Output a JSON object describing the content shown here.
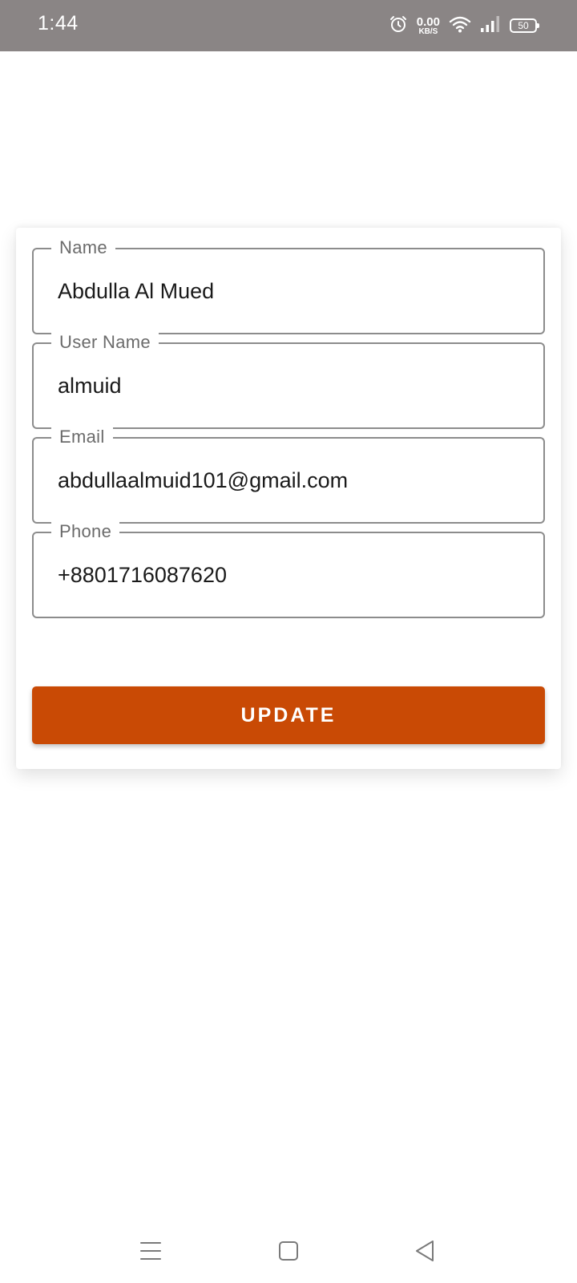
{
  "status_bar": {
    "time": "1:44",
    "net_speed_value": "0.00",
    "net_speed_unit": "KB/S",
    "battery_level": "50",
    "icons": [
      "alarm-icon",
      "wifi-icon",
      "signal-icon",
      "battery-icon"
    ]
  },
  "form": {
    "fields": [
      {
        "label": "Name",
        "value": "Abdulla Al Mued"
      },
      {
        "label": "User Name",
        "value": "almuid"
      },
      {
        "label": "Email",
        "value": "abdullaalmuid101@gmail.com"
      },
      {
        "label": "Phone",
        "value": "+8801716087620"
      }
    ],
    "update_label": "UPDATE"
  },
  "nav_bar": {
    "icons": [
      "menu-icon",
      "home-square-icon",
      "back-triangle-icon"
    ]
  },
  "colors": {
    "status_bar_bg": "#8a8585",
    "accent": "#c94a05",
    "field_border": "#8c8c8c"
  }
}
